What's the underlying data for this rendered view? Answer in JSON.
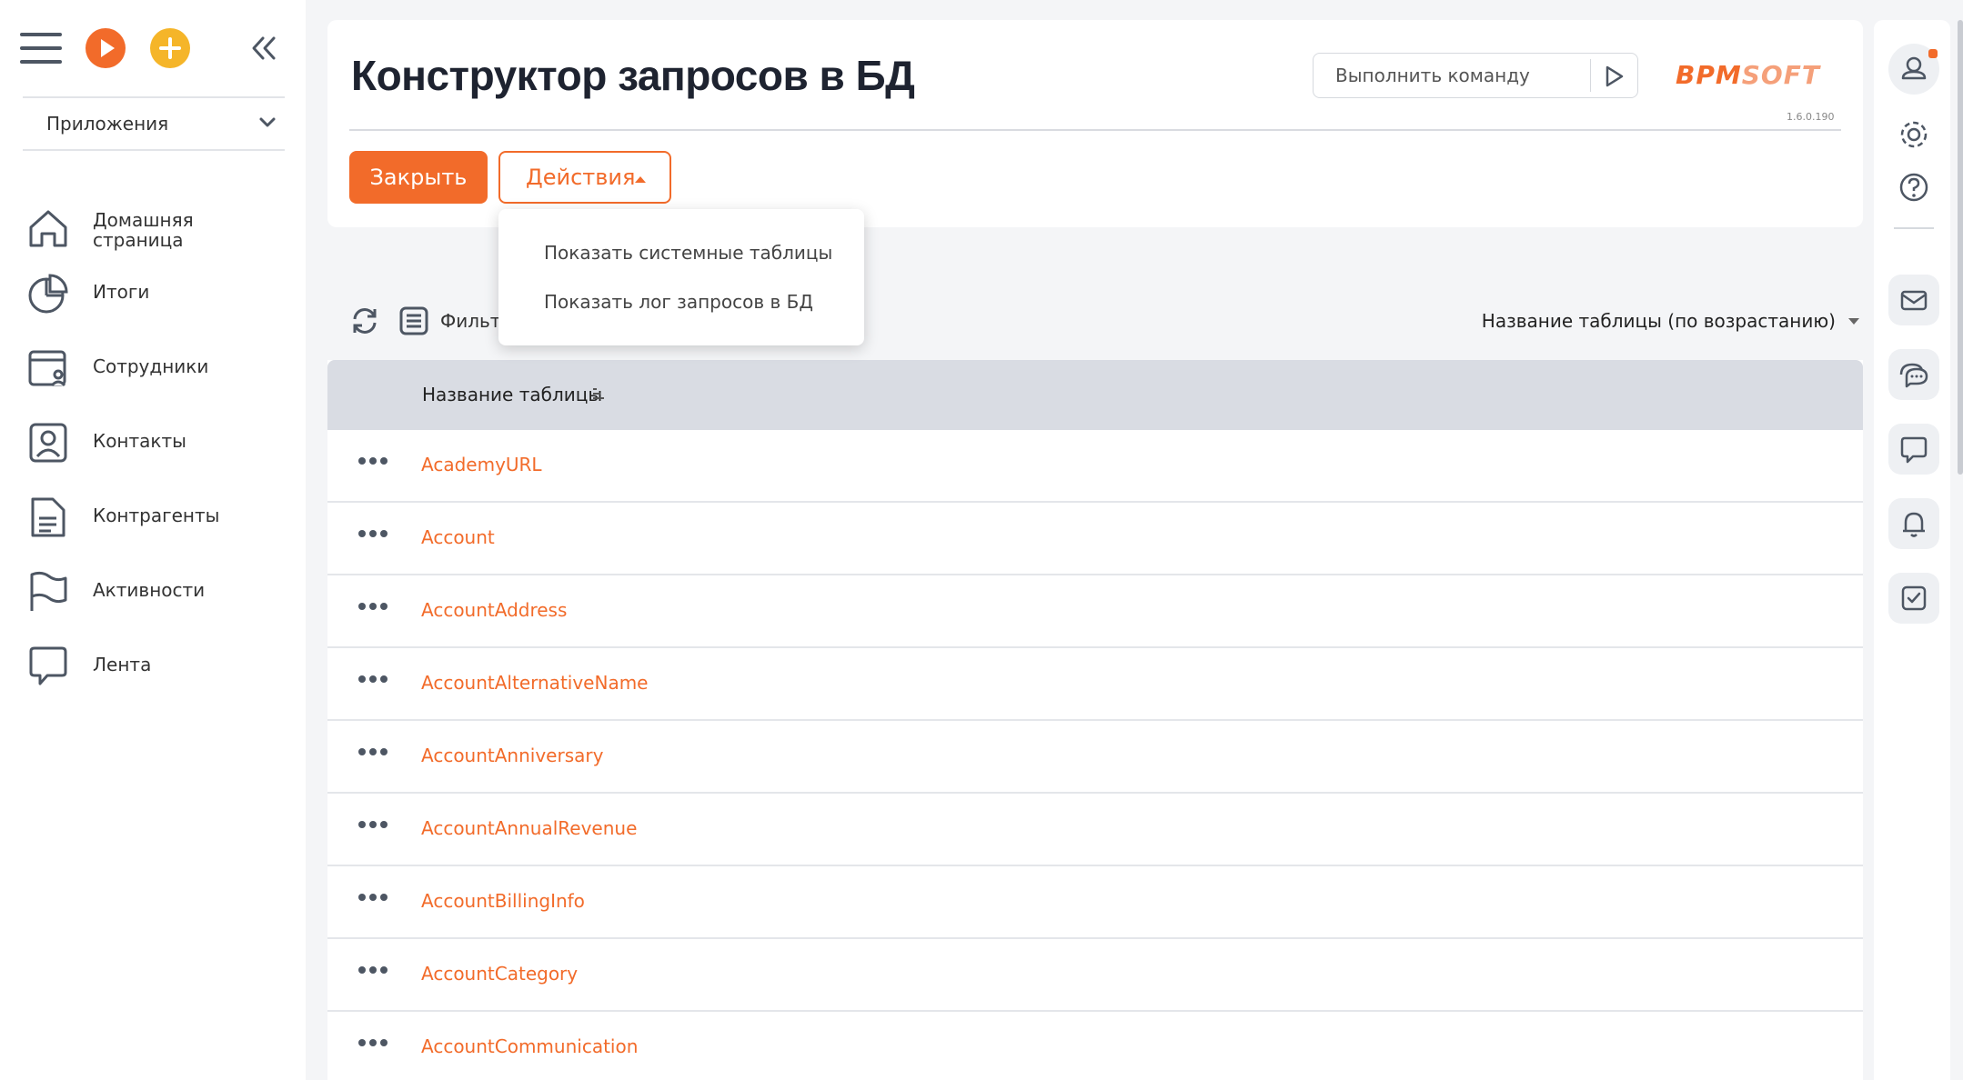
{
  "sidebar": {
    "apps_label": "Приложения",
    "items": [
      {
        "label": "Домашняя\nстраница",
        "icon": "home-icon"
      },
      {
        "label": "Итоги",
        "icon": "pie-chart-icon"
      },
      {
        "label": "Сотрудники",
        "icon": "employees-icon"
      },
      {
        "label": "Контакты",
        "icon": "contact-icon"
      },
      {
        "label": "Контрагенты",
        "icon": "document-icon"
      },
      {
        "label": "Активности",
        "icon": "flag-icon"
      },
      {
        "label": "Лента",
        "icon": "feed-icon"
      }
    ]
  },
  "header": {
    "title": "Конструктор запросов в БД",
    "command_placeholder": "Выполнить команду",
    "logo_left": "BPM",
    "logo_right": "SOFT",
    "version": "1.6.0.190",
    "close_label": "Закрыть",
    "actions_label": "Действия"
  },
  "actions_menu": {
    "items": [
      "Показать системные таблицы",
      "Показать лог запросов в БД"
    ]
  },
  "toolbar": {
    "filter_label": "Фильтр",
    "sort_label": "Название таблицы (по возрастанию)"
  },
  "table": {
    "column_header": "Название таблицы",
    "rows": [
      "AcademyURL",
      "Account",
      "AccountAddress",
      "AccountAlternativeName",
      "AccountAnniversary",
      "AccountAnnualRevenue",
      "AccountBillingInfo",
      "AccountCategory",
      "AccountCommunication"
    ]
  },
  "colors": {
    "accent": "#f26b2a",
    "accent_yellow": "#f5b529",
    "header_row_bg": "#d9dce3"
  }
}
